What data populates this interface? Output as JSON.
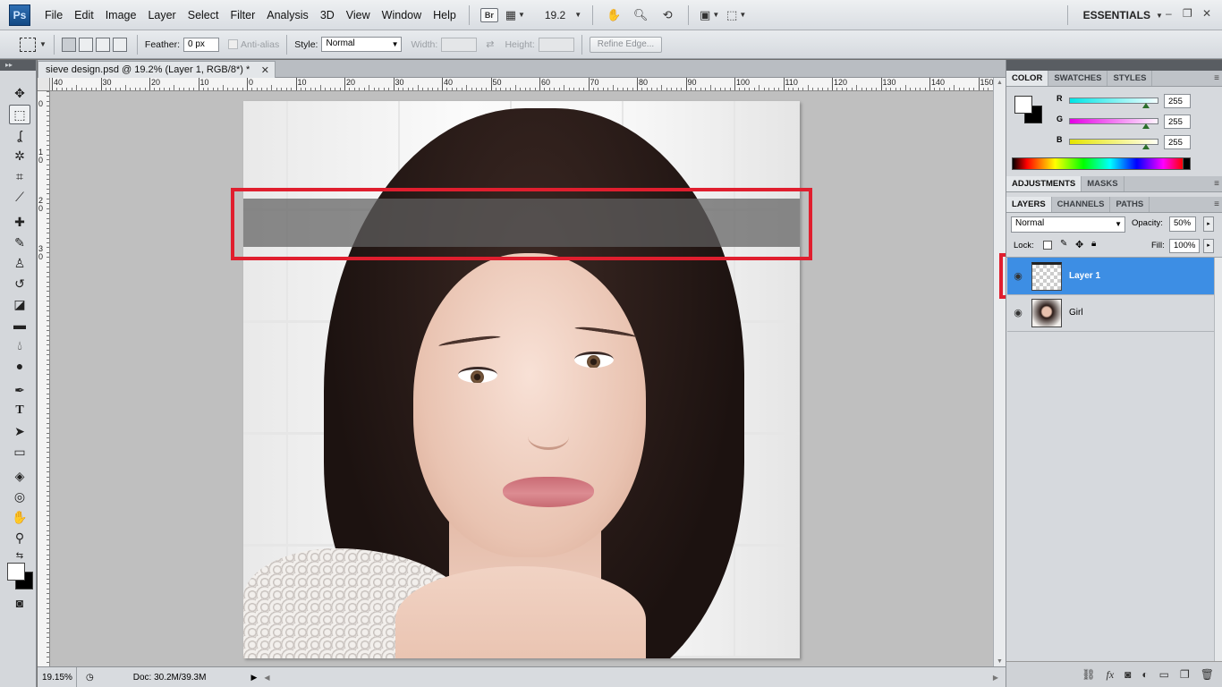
{
  "app": {
    "logo": "Ps",
    "workspace": "ESSENTIALS"
  },
  "menu": [
    "File",
    "Edit",
    "Image",
    "Layer",
    "Select",
    "Filter",
    "Analysis",
    "3D",
    "View",
    "Window",
    "Help"
  ],
  "menubar": {
    "bridge_label": "Br",
    "zoom_value": "19.2",
    "window_controls": [
      "–",
      "❐",
      "✕"
    ]
  },
  "options": {
    "feather_label": "Feather:",
    "feather_value": "0 px",
    "antialias_label": "Anti-alias",
    "style_label": "Style:",
    "style_value": "Normal",
    "width_label": "Width:",
    "height_label": "Height:",
    "refine_edge": "Refine Edge..."
  },
  "document": {
    "tab_title": "sieve design.psd @ 19.2% (Layer 1, RGB/8*) *",
    "close": "✕",
    "zoom": "19.15%",
    "doc_info": "Doc: 30.2M/39.3M"
  },
  "rulers": {
    "top": [
      "40",
      "30",
      "20",
      "10",
      "0",
      "10",
      "20",
      "30",
      "40",
      "50",
      "60",
      "70",
      "80",
      "90",
      "100",
      "110",
      "120",
      "130",
      "140",
      "150"
    ],
    "left": [
      "0",
      "1 0",
      "2 0",
      "3 0"
    ]
  },
  "color_panel": {
    "tabs": [
      "COLOR",
      "SWATCHES",
      "STYLES"
    ],
    "channels": [
      {
        "label": "R",
        "value": "255",
        "color": "#00e5e5"
      },
      {
        "label": "G",
        "value": "255",
        "color": "#e500e5"
      },
      {
        "label": "B",
        "value": "255",
        "color": "#e5e500"
      }
    ]
  },
  "adjust_panel": {
    "tabs": [
      "ADJUSTMENTS",
      "MASKS"
    ]
  },
  "layers_panel": {
    "tabs": [
      "LAYERS",
      "CHANNELS",
      "PATHS"
    ],
    "blend_mode": "Normal",
    "opacity_label": "Opacity:",
    "opacity_value": "50%",
    "lock_label": "Lock:",
    "fill_label": "Fill:",
    "fill_value": "100%",
    "layers": [
      {
        "name": "Layer 1",
        "selected": true
      },
      {
        "name": "Girl",
        "selected": false
      }
    ]
  },
  "highlight_color": "#e01e2e",
  "selection_color": "#3d8ee4"
}
